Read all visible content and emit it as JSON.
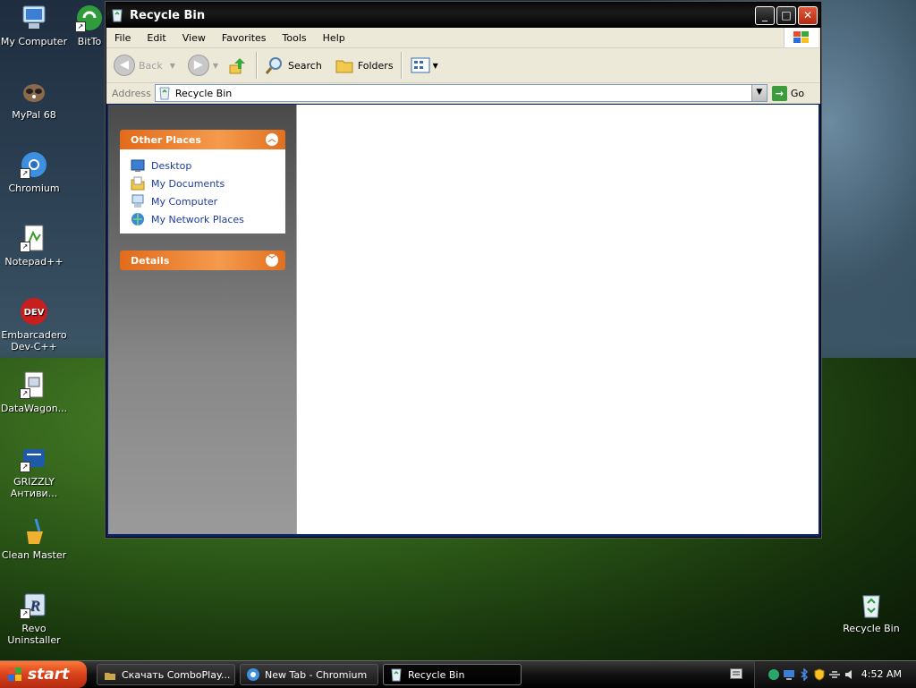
{
  "desktop": {
    "icons": [
      {
        "label": "My Computer"
      },
      {
        "label": "BitTo"
      },
      {
        "label": "MyPal 68"
      },
      {
        "label": "Chromium"
      },
      {
        "label": "Notepad++"
      },
      {
        "label": "Embarcadero Dev-C++"
      },
      {
        "label": "DataWagon..."
      },
      {
        "label": "GRIZZLY Антиви..."
      },
      {
        "label": "Clean Master"
      },
      {
        "label": "Revo Uninstaller"
      },
      {
        "label": "Recycle Bin"
      }
    ]
  },
  "window": {
    "title": "Recycle Bin",
    "menu": [
      "File",
      "Edit",
      "View",
      "Favorites",
      "Tools",
      "Help"
    ],
    "toolbar": {
      "back": "Back",
      "search": "Search",
      "folders": "Folders"
    },
    "address": {
      "label": "Address",
      "value": "Recycle Bin",
      "go": "Go"
    },
    "taskpane": {
      "other_places": {
        "title": "Other Places",
        "links": [
          "Desktop",
          "My Documents",
          "My Computer",
          "My Network Places"
        ]
      },
      "details": {
        "title": "Details"
      }
    }
  },
  "taskbar": {
    "start": "start",
    "tasks": [
      {
        "label": "Скачать ComboPlay..."
      },
      {
        "label": "New Tab - Chromium"
      },
      {
        "label": "Recycle Bin"
      }
    ],
    "clock": "4:52 AM"
  }
}
